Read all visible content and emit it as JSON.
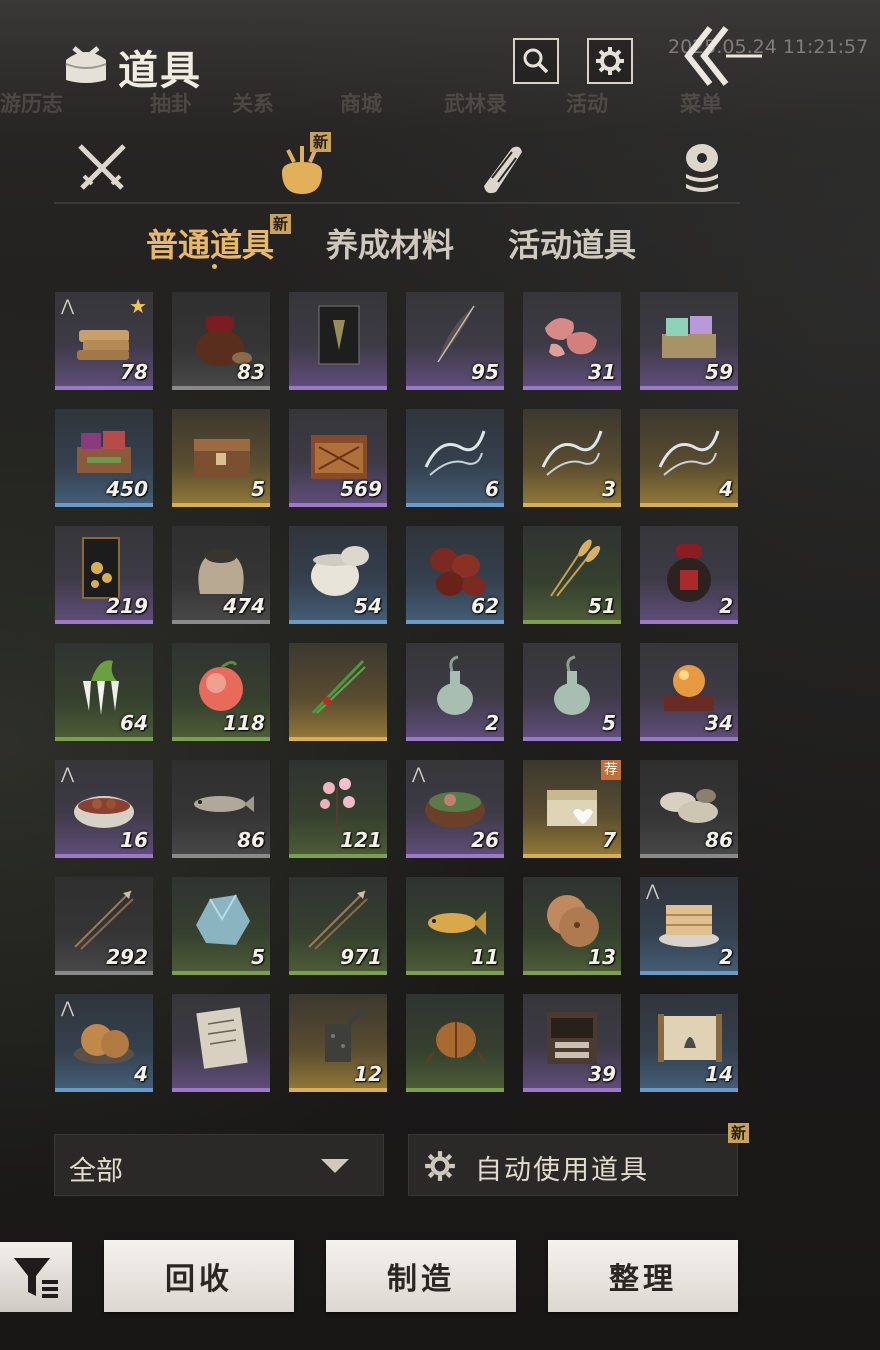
{
  "background_ghost_tabs": [
    "游历志",
    "抽卦",
    "关系",
    "商城",
    "武林录",
    "活动",
    "菜单"
  ],
  "timestamp": "2025.05.24 11:21:57",
  "header": {
    "title": "道具",
    "search_icon": "search-icon",
    "settings_icon": "gear-icon",
    "back_icon": "double-chevron-back-icon"
  },
  "categories": [
    {
      "icon": "crossed-swords-icon",
      "badge": ""
    },
    {
      "icon": "pouch-icon",
      "badge": "新",
      "active": true
    },
    {
      "icon": "scroll-icon",
      "badge": ""
    },
    {
      "icon": "coins-icon",
      "badge": ""
    }
  ],
  "subtabs": [
    {
      "label": "普通道具",
      "badge": "新",
      "active": true
    },
    {
      "label": "养成材料",
      "badge": ""
    },
    {
      "label": "活动道具",
      "badge": ""
    }
  ],
  "items": [
    {
      "count": "78",
      "rarity": "purple",
      "icon": "flatbread",
      "star": true,
      "up": true
    },
    {
      "count": "83",
      "rarity": "gray",
      "icon": "wine-jar"
    },
    {
      "count": "",
      "rarity": "purple",
      "icon": "book-cover"
    },
    {
      "count": "95",
      "rarity": "purple",
      "icon": "feather"
    },
    {
      "count": "31",
      "rarity": "purple",
      "icon": "raw-meat"
    },
    {
      "count": "59",
      "rarity": "purple",
      "icon": "gem-box"
    },
    {
      "count": "450",
      "rarity": "blue",
      "icon": "cloth-box"
    },
    {
      "count": "5",
      "rarity": "gold",
      "icon": "wooden-chest"
    },
    {
      "count": "569",
      "rarity": "purple",
      "icon": "carved-chest"
    },
    {
      "count": "6",
      "rarity": "blue",
      "icon": "silk-wisp"
    },
    {
      "count": "3",
      "rarity": "gold",
      "icon": "silk-wisp"
    },
    {
      "count": "4",
      "rarity": "gold",
      "icon": "silk-wisp"
    },
    {
      "count": "219",
      "rarity": "purple",
      "icon": "flower-card"
    },
    {
      "count": "474",
      "rarity": "gray",
      "icon": "seed-sack"
    },
    {
      "count": "54",
      "rarity": "blue",
      "icon": "porcelain-jar"
    },
    {
      "count": "62",
      "rarity": "blue",
      "icon": "red-dates"
    },
    {
      "count": "51",
      "rarity": "green",
      "icon": "wheat"
    },
    {
      "count": "2",
      "rarity": "purple",
      "icon": "wine-jar-red"
    },
    {
      "count": "64",
      "rarity": "green",
      "icon": "radish"
    },
    {
      "count": "118",
      "rarity": "green",
      "icon": "peach"
    },
    {
      "count": "",
      "rarity": "gold",
      "icon": "chives"
    },
    {
      "count": "2",
      "rarity": "purple",
      "icon": "vase"
    },
    {
      "count": "5",
      "rarity": "purple",
      "icon": "vase"
    },
    {
      "count": "34",
      "rarity": "purple",
      "icon": "crystal-ball"
    },
    {
      "count": "16",
      "rarity": "purple",
      "icon": "meat-bowl",
      "up": true
    },
    {
      "count": "86",
      "rarity": "gray",
      "icon": "fish"
    },
    {
      "count": "121",
      "rarity": "green",
      "icon": "blossom"
    },
    {
      "count": "26",
      "rarity": "purple",
      "icon": "soup-bowl",
      "up": true
    },
    {
      "count": "7",
      "rarity": "gold",
      "icon": "gift-chest",
      "tag": "荐"
    },
    {
      "count": "86",
      "rarity": "gray",
      "icon": "oysters"
    },
    {
      "count": "292",
      "rarity": "gray",
      "icon": "arrows"
    },
    {
      "count": "5",
      "rarity": "green",
      "icon": "ore"
    },
    {
      "count": "971",
      "rarity": "green",
      "icon": "arrows"
    },
    {
      "count": "11",
      "rarity": "green",
      "icon": "carp"
    },
    {
      "count": "13",
      "rarity": "green",
      "icon": "pancakes"
    },
    {
      "count": "2",
      "rarity": "blue",
      "icon": "layered-cake",
      "up": true
    },
    {
      "count": "4",
      "rarity": "blue",
      "icon": "sesame-cakes",
      "up": true
    },
    {
      "count": "",
      "rarity": "purple",
      "icon": "letter"
    },
    {
      "count": "12",
      "rarity": "gold",
      "icon": "bell"
    },
    {
      "count": "",
      "rarity": "green",
      "icon": "beetle"
    },
    {
      "count": "39",
      "rarity": "purple",
      "icon": "cabinet"
    },
    {
      "count": "14",
      "rarity": "blue",
      "icon": "scroll-painting"
    }
  ],
  "filter": {
    "selected": "全部"
  },
  "auto_use": {
    "label": "自动使用道具",
    "badge": "新"
  },
  "actions": {
    "sort_icon": "filter-list-icon",
    "recycle": "回收",
    "craft": "制造",
    "arrange": "整理"
  },
  "colors": {
    "accent": "#e8b868",
    "badge": "#c9a35c",
    "purple": "#9a7ac8",
    "gold": "#d8b050",
    "green": "#7aa050",
    "blue": "#6a9ac8"
  }
}
